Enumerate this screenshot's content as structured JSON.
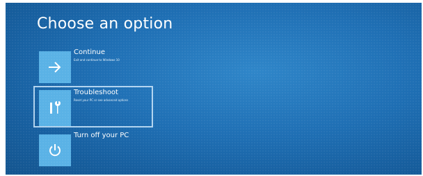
{
  "page_title": "Choose an option",
  "options": [
    {
      "label": "Continue",
      "description": "Exit and continue to Windows 10",
      "icon": "arrow-right-icon",
      "selected": false
    },
    {
      "label": "Troubleshoot",
      "description": "Reset your PC or see advanced options",
      "icon": "tools-icon",
      "selected": true
    },
    {
      "label": "Turn off your PC",
      "description": "",
      "icon": "power-icon",
      "selected": false
    }
  ],
  "colors": {
    "background": "#1f6fb4",
    "tile": "#5ab2e6",
    "selection_border": "#cde6fa",
    "text": "#ffffff"
  }
}
